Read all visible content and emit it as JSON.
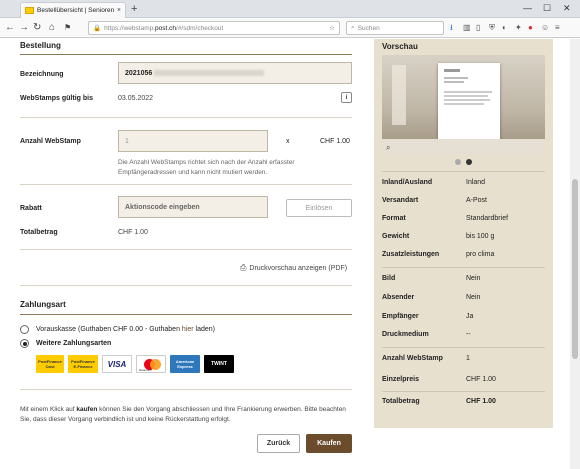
{
  "browser": {
    "tab_title": "Bestellübersicht | Seniorenbrief fr...",
    "url_prefix": "https://webstamp.",
    "url_domain": "post.ch",
    "url_path": "/#/sdm/checkout",
    "search_placeholder": "Suchen",
    "new_tab": "+",
    "close": "×"
  },
  "order": {
    "heading": "Bestellung",
    "bezeichnung_label": "Bezeichnung",
    "bezeichnung_value": "2021056",
    "gueltig_label": "WebStamps gültig bis",
    "gueltig_value": "03.05.2022",
    "info_icon": "i",
    "anzahl_label": "Anzahl WebStamp",
    "anzahl_value": "1",
    "multiplier": "x",
    "anzahl_price": "CHF 1.00",
    "anzahl_note": "Die Anzahl WebStamps richtet sich nach der Anzahl erfasster Empfängeradressen und kann nicht mutiert werden.",
    "rabatt_label": "Rabatt",
    "rabatt_placeholder": "Aktionscode eingeben",
    "einloesen_label": "Einlösen",
    "total_label": "Totalbetrag",
    "total_value": "CHF 1.00",
    "print_preview_label": "Druckvorschau anzeigen (PDF)"
  },
  "payment": {
    "heading": "Zahlungsart",
    "option1_pre": "Vorauskasse (Guthaben CHF 0.00 - Guthaben ",
    "option1_link": "hier",
    "option1_post": " laden)",
    "option2": "Weitere Zahlungsarten",
    "methods": [
      "PostFinance Card",
      "PostFinance E-Finance",
      "VISA",
      "Mastercard",
      "American Express",
      "TWINT"
    ]
  },
  "footer": {
    "text_pre": "Mit einem Klick auf ",
    "text_bold": "kaufen",
    "text_post": " können Sie den Vorgang abschliessen und Ihre Frankierung erwerben. Bitte beachten Sie, dass dieser Vorgang verbindlich ist und keine Rückerstattung erfolgt.",
    "back_label": "Zurück",
    "buy_label": "Kaufen"
  },
  "preview": {
    "heading": "Vorschau",
    "rows": [
      {
        "k": "Inland/Ausland",
        "v": "Inland"
      },
      {
        "k": "Versandart",
        "v": "A-Post"
      },
      {
        "k": "Format",
        "v": "Standardbrief"
      },
      {
        "k": "Gewicht",
        "v": "bis 100 g"
      },
      {
        "k": "Zusatzleistungen",
        "v": "pro clima"
      },
      {
        "k": "Bild",
        "v": "Nein"
      },
      {
        "k": "Absender",
        "v": "Nein"
      },
      {
        "k": "Empfänger",
        "v": "Ja"
      },
      {
        "k": "Druckmedium",
        "v": "--"
      },
      {
        "k": "Anzahl WebStamp",
        "v": "1"
      },
      {
        "k": "Einzelpreis",
        "v": "CHF 1.00"
      },
      {
        "k": "Totalbetrag",
        "v": "CHF 1.00"
      }
    ]
  },
  "colors": {
    "accent": "#6b4c2c",
    "panel": "#e8e0cf",
    "input_bg": "#f4efe6"
  }
}
